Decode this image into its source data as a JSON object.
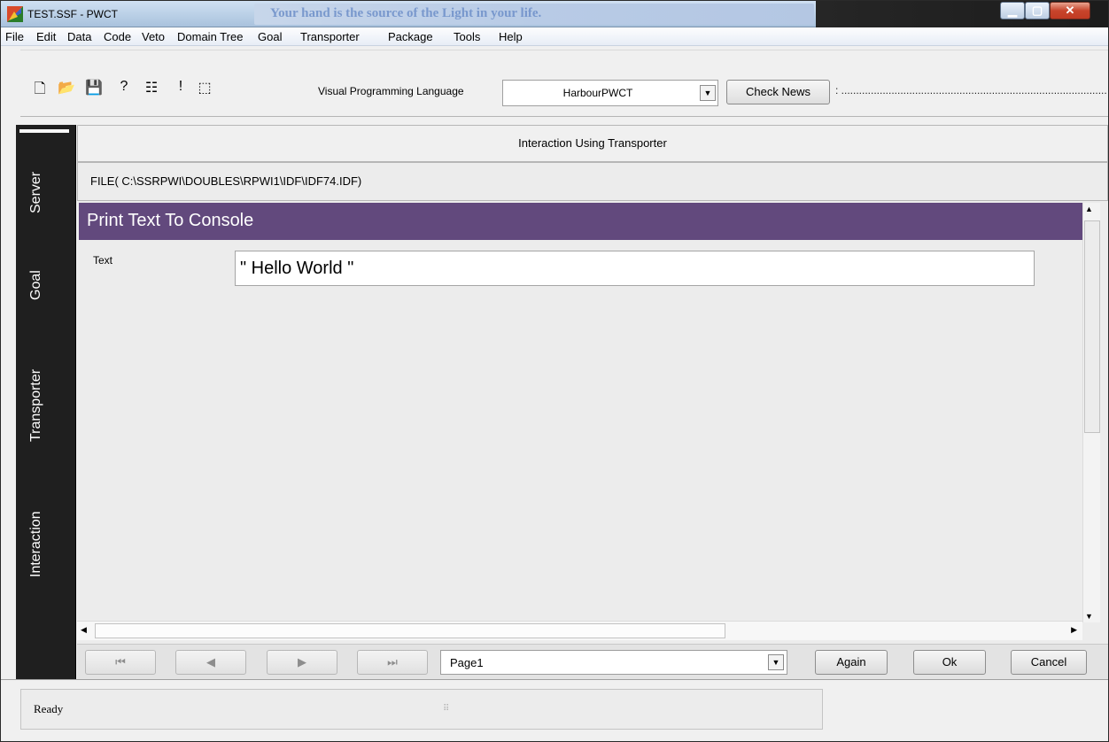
{
  "window": {
    "title": "TEST.SSF  - PWCT",
    "banner": "Your hand is the source of the Light in your life."
  },
  "menu": [
    "File",
    "Edit",
    "Data",
    "Code",
    "Veto",
    "Domain Tree",
    "Goal",
    "Transporter",
    "Package",
    "Tools",
    "Help"
  ],
  "toolbar": {
    "icons": [
      "new-file-icon",
      "open-folder-icon",
      "save-disk-icon",
      "help-icon",
      "document-icon",
      "exclamation-icon",
      "open-box-icon"
    ],
    "vpl_label": "Visual Programming Language",
    "vpl_value": "HarbourPWCT",
    "check_news": "Check News",
    "news_text": ": ...................................................................................................................................................................."
  },
  "side_tabs": [
    "Server",
    "Goal",
    "Transporter",
    "Interaction"
  ],
  "main": {
    "header": "Interaction Using Transporter",
    "file": "FILE( C:\\SSRPWI\\DOUBLES\\RPWI1\\IDF\\IDF74.IDF)",
    "section_title": "Print Text To Console",
    "field_label": "Text",
    "field_value": "\" Hello World \""
  },
  "nav": {
    "first": "⏮",
    "prev": "◀",
    "next": "▶",
    "last": "⏭",
    "page": "Page1",
    "again": "Again",
    "ok": "Ok",
    "cancel": "Cancel"
  },
  "status": {
    "text": "Ready"
  }
}
